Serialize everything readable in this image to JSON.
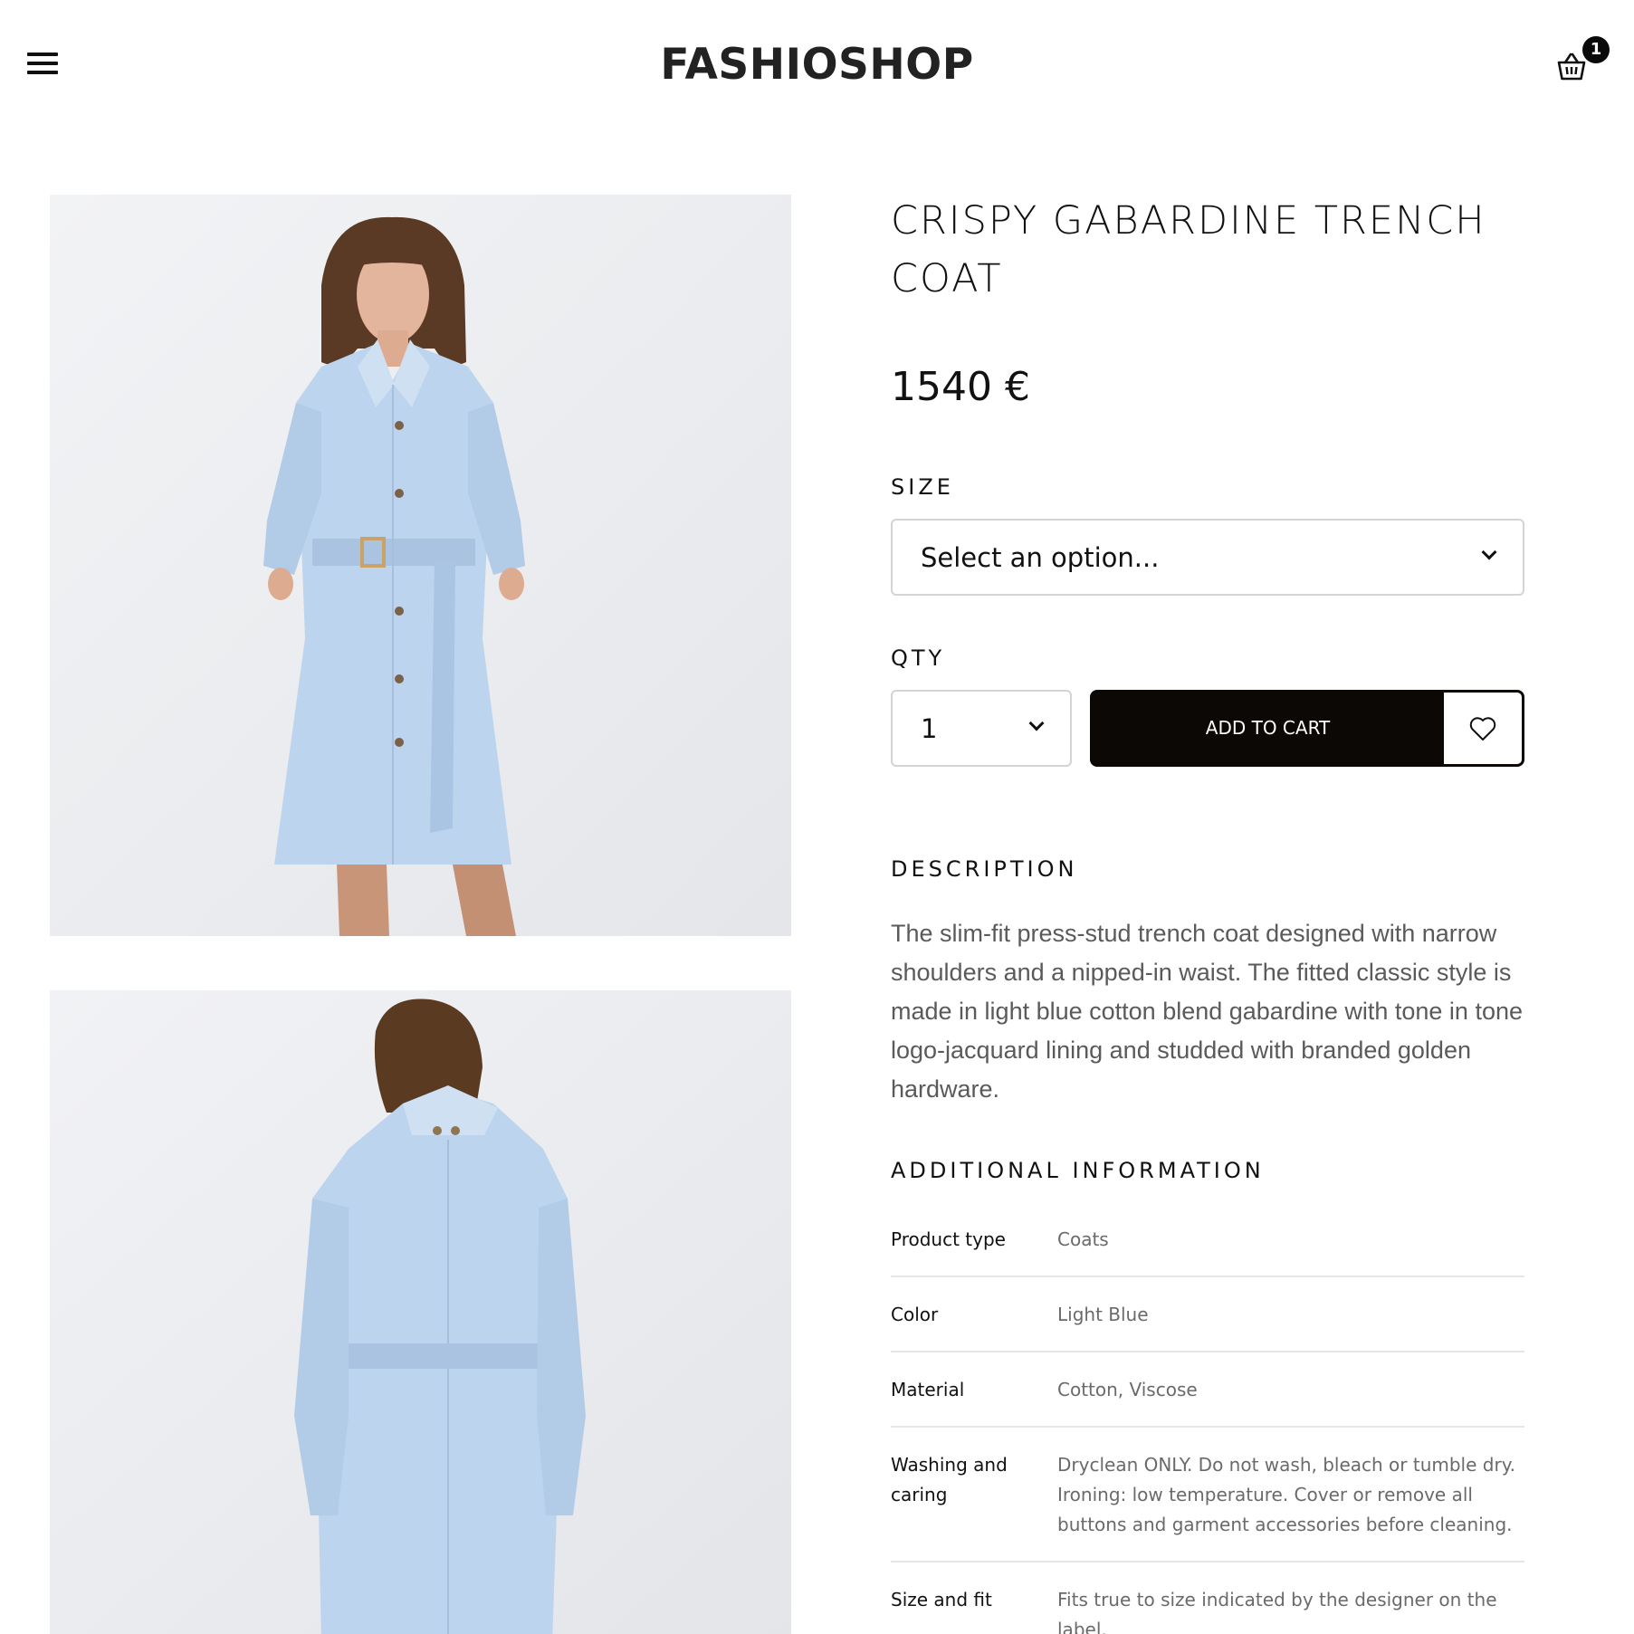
{
  "header": {
    "brand": "FASHIOSHOP",
    "cart_count": "1"
  },
  "product": {
    "title": "CRISPY GABARDINE TRENCH COAT",
    "price": "1540 €",
    "size_label": "SIZE",
    "size_value": "Select an option...",
    "qty_label": "QTY",
    "qty_value": "1",
    "add_to_cart_label": "ADD TO CART",
    "description_heading": "DESCRIPTION",
    "description": "The slim-fit press-stud trench coat designed with narrow shoulders and a nipped-in waist. The fitted classic style is made in light blue cotton blend gabardine with tone in tone logo-jacquard lining and studded with branded golden hardware.",
    "additional_heading": "ADDITIONAL INFORMATION",
    "info": [
      {
        "label": "Product type",
        "value": "Coats"
      },
      {
        "label": "Color",
        "value": "Light Blue"
      },
      {
        "label": "Material",
        "value": "Cotton, Viscose"
      },
      {
        "label": "Washing and caring",
        "value": "Dryclean ONLY. Do not wash, bleach or tumble dry. Ironing: low temperature. Cover or remove all buttons and garment accessories before cleaning."
      },
      {
        "label": "Size and fit",
        "value": "Fits true to size indicated by the designer on the label."
      }
    ]
  },
  "colors": {
    "accent": "#0b0806",
    "coat": "#bcd4ee",
    "text_muted": "#5a5a5a"
  },
  "icons": [
    "menu-icon",
    "cart-icon",
    "chevron-down-icon",
    "heart-icon"
  ]
}
